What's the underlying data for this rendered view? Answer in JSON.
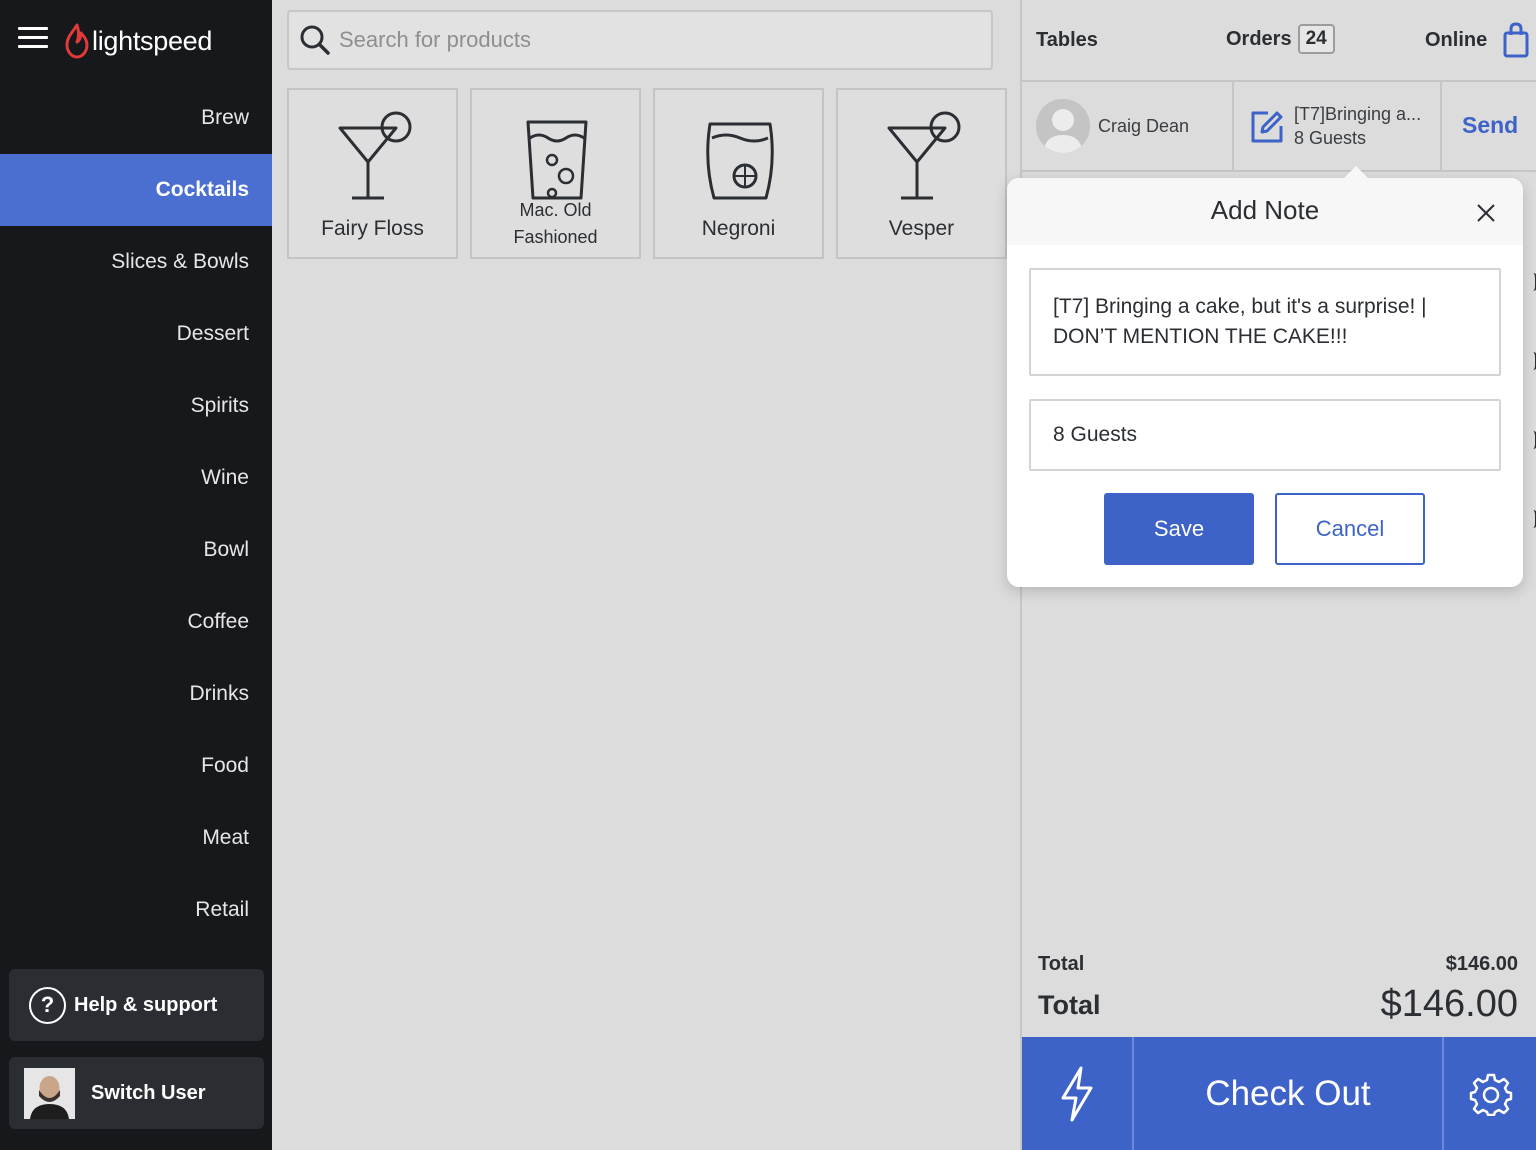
{
  "brand": {
    "name": "lightspeed",
    "accent": "#e03a3a"
  },
  "sidebar": {
    "items": [
      {
        "label": "Brew"
      },
      {
        "label": "Cocktails",
        "active": true
      },
      {
        "label": "Slices & Bowls"
      },
      {
        "label": "Dessert"
      },
      {
        "label": "Spirits"
      },
      {
        "label": "Wine"
      },
      {
        "label": "Bowl"
      },
      {
        "label": "Coffee"
      },
      {
        "label": "Drinks"
      },
      {
        "label": "Food"
      },
      {
        "label": "Meat"
      },
      {
        "label": "Retail"
      }
    ],
    "help_label": "Help & support",
    "help_icon": "question-circle-icon",
    "switch_user_label": "Switch User",
    "active_color": "#4a6fd1"
  },
  "search": {
    "placeholder": "Search for products",
    "value": ""
  },
  "products": [
    {
      "name": "Fairy Floss",
      "icon": "martini-glass-icon"
    },
    {
      "name_line1": "Mac. Old",
      "name_line2": "Fashioned",
      "icon": "highball-glass-icon"
    },
    {
      "name": "Negroni",
      "icon": "rocks-glass-icon"
    },
    {
      "name": "Vesper",
      "icon": "martini-glass-icon"
    }
  ],
  "order_panel": {
    "tables_label": "Tables",
    "orders_label": "Orders",
    "orders_count": "24",
    "online_label": "Online",
    "customer_name": "Craig Dean",
    "note_preview": "[T7]Bringing a...",
    "guests_preview": "8 Guests",
    "send_label": "Send",
    "subtotal_label": "Total",
    "subtotal_value": "$146.00",
    "total_label": "Total",
    "total_value": "$146.00",
    "checkout_label": "Check Out",
    "primary_color": "#3d63c9"
  },
  "modal": {
    "title": "Add Note",
    "note_value": "[T7] Bringing a cake, but it's a surprise! | DON’T MENTION THE CAKE!!!",
    "guests_value": "8 Guests",
    "save_label": "Save",
    "cancel_label": "Cancel"
  }
}
